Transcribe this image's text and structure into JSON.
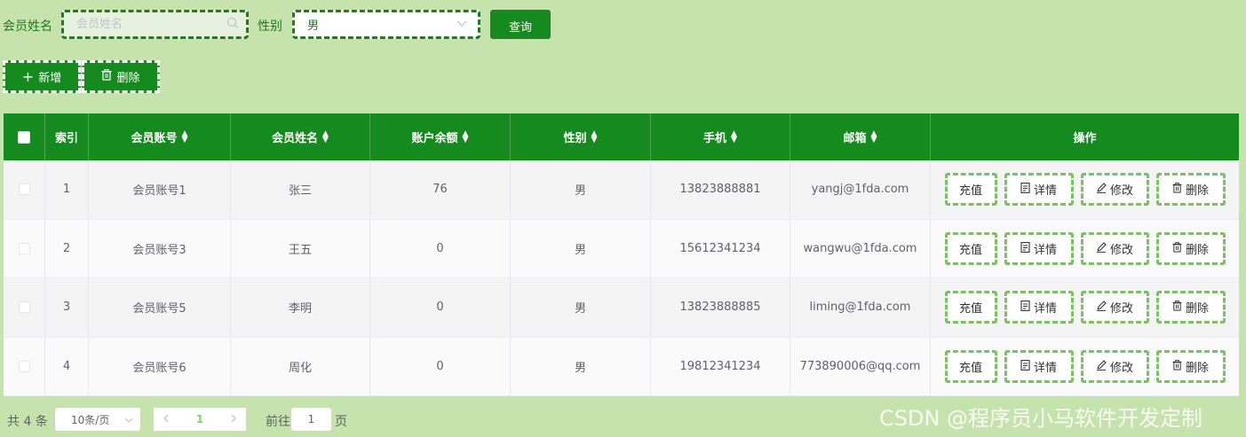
{
  "search": {
    "name_label": "会员姓名",
    "name_placeholder": "会员姓名",
    "gender_label": "性别",
    "gender_value": "男",
    "query_label": "查询"
  },
  "toolbar": {
    "add_label": "新增",
    "delete_label": "删除"
  },
  "table": {
    "headers": {
      "index": "索引",
      "account": "会员账号",
      "name": "会员姓名",
      "balance": "账户余额",
      "gender": "性别",
      "phone": "手机",
      "email": "邮箱",
      "ops": "操作"
    },
    "rows": [
      {
        "index": "1",
        "account": "会员账号1",
        "name": "张三",
        "balance": "76",
        "gender": "男",
        "phone": "13823888881",
        "email": "yangj@1fda.com"
      },
      {
        "index": "2",
        "account": "会员账号3",
        "name": "王五",
        "balance": "0",
        "gender": "男",
        "phone": "15612341234",
        "email": "wangwu@1fda.com"
      },
      {
        "index": "3",
        "account": "会员账号5",
        "name": "李明",
        "balance": "0",
        "gender": "男",
        "phone": "13823888885",
        "email": "liming@1fda.com"
      },
      {
        "index": "4",
        "account": "会员账号6",
        "name": "周化",
        "balance": "0",
        "gender": "男",
        "phone": "19812341234",
        "email": "773890006@qq.com"
      }
    ],
    "ops": {
      "recharge": "充值",
      "detail": "详情",
      "edit": "修改",
      "delete": "删除"
    }
  },
  "pagination": {
    "total": "共 4 条",
    "page_size": "10条/页",
    "current_page": "1",
    "goto_label": "前往",
    "goto_value": "1",
    "page_suffix": "页"
  },
  "watermark": "CSDN @程序员小马软件开发定制",
  "colors": {
    "background": "#c6e3ad",
    "primary": "#158a1f",
    "dashed_border": "#7bc063"
  }
}
